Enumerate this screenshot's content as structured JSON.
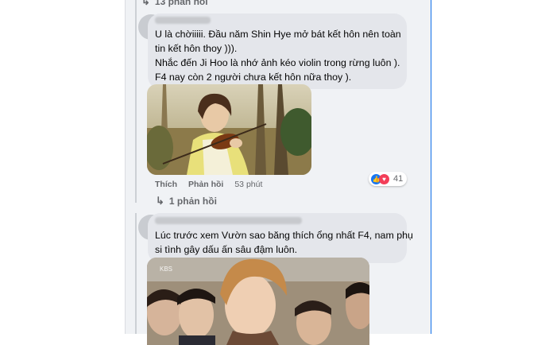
{
  "thread_top": {
    "reply_label": "13 phản hồi"
  },
  "comment1": {
    "lines": [
      "U là chờiiiii. Đầu năm Shin Hye mở bát kết hôn nên toàn",
      "tin kết hôn thoy ))).",
      "Nhắc đến Ji Hoo là nhớ ảnh kéo violin trong rừng luôn ).",
      "F4 nay còn 2 người chưa kết hôn nữa thoy )."
    ],
    "actions": {
      "like": "Thích",
      "reply": "Phản hồi",
      "time": "53 phút"
    },
    "reaction_count": "41",
    "replies_label": "1 phản hồi"
  },
  "comment2": {
    "lines": [
      "Lúc trước xem Vườn sao băng thích ổng nhất F4, nam phụ",
      "si tình gây dấu ấn sâu đậm luôn."
    ],
    "photo_watermark": "KBS"
  },
  "colors": {
    "bubble": "#e4e6eb",
    "feed_bg": "#f0f2f5",
    "accent": "#1877f2",
    "meta": "#65676b"
  }
}
